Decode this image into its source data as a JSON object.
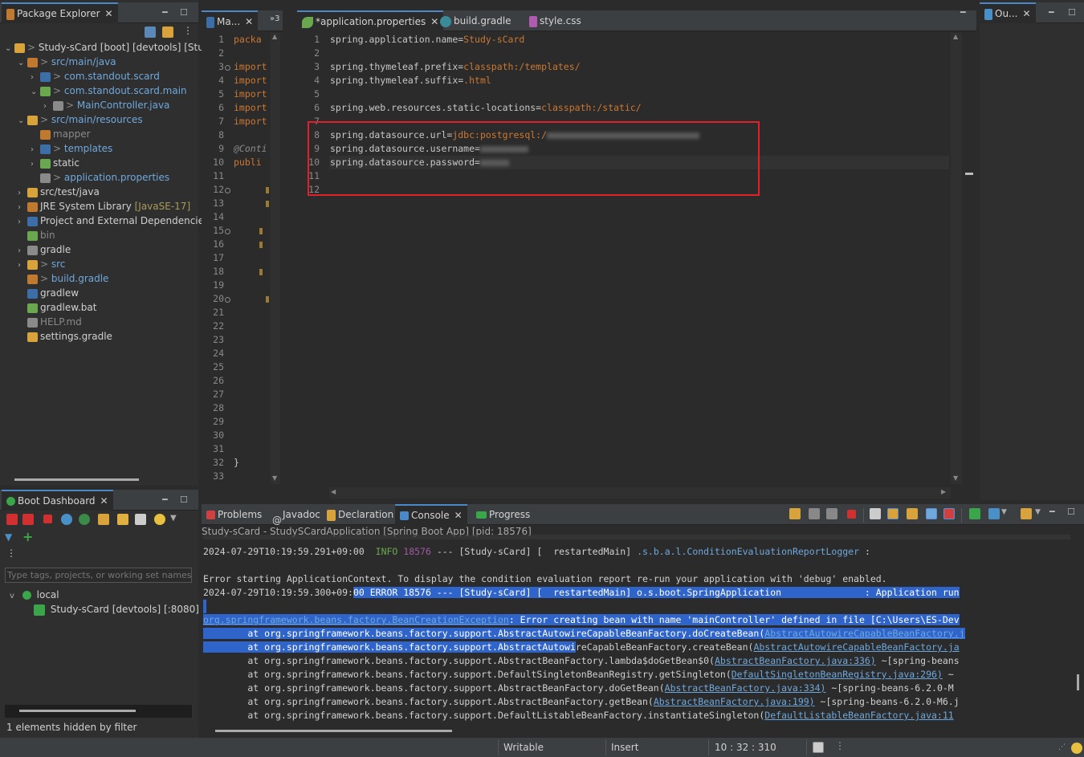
{
  "package_explorer": {
    "tab_label": "Package Explorer",
    "tree": [
      {
        "text": "Study-sCard [boot] [devtools] [Stud",
        "prefix": "> ",
        "indent": 0,
        "arrow": "v",
        "color": "normal"
      },
      {
        "text": "src/main/java",
        "prefix": "> ",
        "indent": 1,
        "arrow": "v",
        "color": "blue"
      },
      {
        "text": "com.standout.scard",
        "prefix": "> ",
        "indent": 2,
        "arrow": ">",
        "color": "blue"
      },
      {
        "text": "com.standout.scard.main",
        "prefix": "> ",
        "indent": 2,
        "arrow": "v",
        "color": "blue"
      },
      {
        "text": "MainController.java",
        "prefix": "> ",
        "indent": 3,
        "arrow": ">",
        "color": "blue"
      },
      {
        "text": "src/main/resources",
        "prefix": "> ",
        "indent": 1,
        "arrow": "v",
        "color": "blue"
      },
      {
        "text": "mapper",
        "prefix": "",
        "indent": 2,
        "arrow": "",
        "color": "grey"
      },
      {
        "text": "templates",
        "prefix": "> ",
        "indent": 2,
        "arrow": ">",
        "color": "blue"
      },
      {
        "text": "static",
        "prefix": "",
        "indent": 2,
        "arrow": ">",
        "color": "normal"
      },
      {
        "text": "application.properties",
        "prefix": "> ",
        "indent": 2,
        "arrow": "",
        "color": "blue"
      },
      {
        "text": "src/test/java",
        "prefix": "",
        "indent": 1,
        "arrow": ">",
        "color": "normal"
      },
      {
        "text": "JRE System Library ",
        "suffix": "[JavaSE-17]",
        "prefix": "",
        "indent": 1,
        "arrow": ">",
        "color": "normal"
      },
      {
        "text": "Project and External Dependencies",
        "prefix": "",
        "indent": 1,
        "arrow": ">",
        "color": "normal"
      },
      {
        "text": "bin",
        "prefix": "",
        "indent": 1,
        "arrow": "",
        "color": "grey"
      },
      {
        "text": "gradle",
        "prefix": "",
        "indent": 1,
        "arrow": ">",
        "color": "normal"
      },
      {
        "text": "src",
        "prefix": "> ",
        "indent": 1,
        "arrow": ">",
        "color": "blue"
      },
      {
        "text": "build.gradle",
        "prefix": "> ",
        "indent": 1,
        "arrow": "",
        "color": "blue"
      },
      {
        "text": "gradlew",
        "prefix": "",
        "indent": 1,
        "arrow": "",
        "color": "normal"
      },
      {
        "text": "gradlew.bat",
        "prefix": "",
        "indent": 1,
        "arrow": "",
        "color": "normal"
      },
      {
        "text": "HELP.md",
        "prefix": "",
        "indent": 1,
        "arrow": "",
        "color": "grey"
      },
      {
        "text": "settings.gradle",
        "prefix": "",
        "indent": 1,
        "arrow": "",
        "color": "normal"
      }
    ]
  },
  "boot_dashboard": {
    "tab_label": "Boot Dashboard",
    "filter_placeholder": "Type tags, projects, or working set names t",
    "group": "local",
    "app": "Study-sCard [devtools] [:8080]",
    "footer": "1 elements hidden by filter"
  },
  "left_editor": {
    "tab_label": "Ma...",
    "overflow_label": "»3",
    "lines": [
      "1",
      "2",
      "3",
      "4",
      "5",
      "6",
      "7",
      "8",
      "9",
      "10",
      "11",
      "12",
      "13",
      "14",
      "15",
      "16",
      "17",
      "18",
      "19",
      "20",
      "21",
      "22",
      "23",
      "24",
      "25",
      "26",
      "27",
      "28",
      "29",
      "30",
      "31",
      "32",
      "33"
    ],
    "code": [
      {
        "text": "packa",
        "row": 0,
        "color": "orange"
      },
      {
        "text": "import",
        "row": 2,
        "color": "orange"
      },
      {
        "text": "import",
        "row": 3,
        "color": "orange"
      },
      {
        "text": "import",
        "row": 4,
        "color": "orange"
      },
      {
        "text": "import",
        "row": 5,
        "color": "orange"
      },
      {
        "text": "import",
        "row": 6,
        "color": "orange"
      },
      {
        "text": "@Conti",
        "row": 8,
        "color": "grey"
      },
      {
        "text": "publi",
        "row": 9,
        "color": "orange"
      },
      {
        "text": "}",
        "row": 31,
        "color": "normal"
      }
    ]
  },
  "editor_tabs": [
    {
      "label": "*application.properties",
      "active": true
    },
    {
      "label": "build.gradle",
      "active": false
    },
    {
      "label": "style.css",
      "active": false
    }
  ],
  "properties_file": {
    "lines": [
      {
        "n": "1",
        "key": "spring.application.name=",
        "value": "Study-sCard"
      },
      {
        "n": "2",
        "key": "",
        "value": ""
      },
      {
        "n": "3",
        "key": "spring.thymeleaf.prefix=",
        "value": "classpath:/templates/"
      },
      {
        "n": "4",
        "key": "spring.thymeleaf.suffix=",
        "value": ".html"
      },
      {
        "n": "5",
        "key": "",
        "value": ""
      },
      {
        "n": "6",
        "key": "spring.web.resources.static-locations=",
        "value": "classpath:/static/"
      },
      {
        "n": "7",
        "key": "",
        "value": ""
      },
      {
        "n": "8",
        "key": "spring.datasource.url=",
        "value": "jdbc:postgresql:/"
      },
      {
        "n": "9",
        "key": "spring.datasource.username=",
        "value": ""
      },
      {
        "n": "10",
        "key": "spring.datasource.password=",
        "value": ""
      },
      {
        "n": "11",
        "key": "",
        "value": ""
      },
      {
        "n": "12",
        "key": "",
        "value": ""
      }
    ]
  },
  "outline": {
    "tab_label": "Ou..."
  },
  "bottom_tabs": [
    {
      "label": "Problems",
      "active": false
    },
    {
      "label": "Javadoc",
      "active": false
    },
    {
      "label": "Declaration",
      "active": false
    },
    {
      "label": "Console",
      "active": true
    },
    {
      "label": "Progress",
      "active": false
    }
  ],
  "console": {
    "header": "Study-sCard - StudySCardApplication [Spring Boot App]  [pid: 18576]",
    "lines": [
      {
        "a": "2024-07-29T10:19:59.291+09:00  ",
        "b": "INFO",
        "c": " 18576",
        "d": " --- [Study-sCard] [  restartedMain] ",
        "e": ".s.b.a.l.ConditionEvaluationReportLogger",
        "f": " :"
      },
      {
        "plain": ""
      },
      {
        "plain": "Error starting ApplicationContext. To display the condition evaluation report re-run your application with 'debug' enabled."
      },
      {
        "pre": "2024-07-29T10:19:59.300+09:",
        "sel": "00 ERROR 18576 --- [Study-sCard] [  restartedMain] o.s.boot.SpringApplication               : Application run"
      },
      {
        "sel": " "
      },
      {
        "sel_link": "org.springframework.beans.factory.BeanCreationException",
        "sel": ": Error creating bean with name 'mainController' defined in file [C:\\Users\\ES-Dev"
      },
      {
        "sel": "        at org.springframework.beans.factory.support.AbstractAutowireCapableBeanFactory.doCreateBean(",
        "sel_link2": "AbstractAutowireCapableBeanFactory.j"
      },
      {
        "sel": "        at org.springframework.beans.factory.support.AbstractAutowi",
        "rest": "reCapableBeanFactory.createBean(",
        "link": "AbstractAutowireCapableBeanFactory.ja"
      },
      {
        "plain": "        at org.springframework.beans.factory.support.AbstractBeanFactory.lambda$doGetBean$0(",
        "link": "AbstractBeanFactory.java:336)",
        "tail": " ~[spring-beans"
      },
      {
        "plain": "        at org.springframework.beans.factory.support.DefaultSingletonBeanRegistry.getSingleton(",
        "link": "DefaultSingletonBeanRegistry.java:296)",
        "tail": " ~"
      },
      {
        "plain": "        at org.springframework.beans.factory.support.AbstractBeanFactory.doGetBean(",
        "link": "AbstractBeanFactory.java:334)",
        "tail": " ~[spring-beans-6.2.0-M"
      },
      {
        "plain": "        at org.springframework.beans.factory.support.AbstractBeanFactory.getBean(",
        "link": "AbstractBeanFactory.java:199)",
        "tail": " ~[spring-beans-6.2.0-M6.j"
      },
      {
        "plain": "        at org.springframework.beans.factory.support.DefaultListableBeanFactory.instantiateSingleton(",
        "link": "DefaultListableBeanFactory.java:11"
      }
    ]
  },
  "status_bar": {
    "writable": "Writable",
    "insert": "Insert",
    "position": "10 : 32 : 310"
  },
  "colors": {
    "accent": "#4a88c7",
    "selection": "#2f65ca",
    "highlight_box": "#e0202a",
    "error": "#e0202a"
  }
}
